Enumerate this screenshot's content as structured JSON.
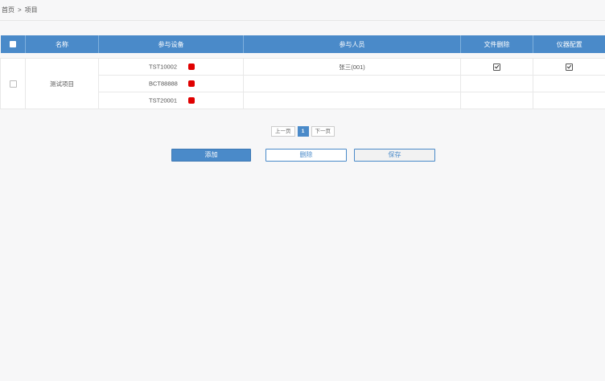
{
  "breadcrumb": {
    "home": "首页",
    "separator": ">",
    "current": "项目"
  },
  "table": {
    "headers": {
      "name": "名称",
      "devices": "参与设备",
      "people": "参与人员",
      "file_delete": "文件删除",
      "instrument_config": "仪器配置"
    },
    "project": {
      "name": "测试项目",
      "rows": [
        {
          "device": "TST10002",
          "status_color": "#e00000",
          "person": "张三(001)",
          "file_delete": true,
          "instrument_config": true
        },
        {
          "device": "BCT88888",
          "status_color": "#e00000",
          "person": "",
          "file_delete": false,
          "instrument_config": false
        },
        {
          "device": "TST20001",
          "status_color": "#e00000",
          "person": "",
          "file_delete": false,
          "instrument_config": false
        }
      ]
    }
  },
  "pagination": {
    "prev": "上一页",
    "current": "1",
    "next": "下一页"
  },
  "actions": {
    "add": "添加",
    "delete": "删除",
    "save": "保存"
  },
  "colors": {
    "accent": "#4a8ac9",
    "status": "#e00000"
  }
}
